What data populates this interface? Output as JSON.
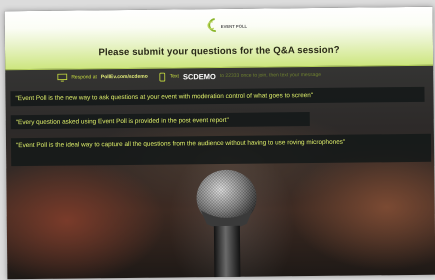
{
  "header": {
    "logo_text": "EVENT POLL",
    "title": "Please submit your questions for the Q&A session?"
  },
  "instructions": {
    "respond_prefix": "Respond at",
    "respond_url": "PollEv.com/scdemo",
    "text_prefix": "Text",
    "text_code": "SCDEMO",
    "text_suffix": "to 22333 once to join, then text your message"
  },
  "questions": [
    "\"Event Poll is the new way to ask questions at your event with moderation control of what goes to screen\"",
    "\"Every question asked using Event Poll is provided in the post event report\"",
    "\"Event Poll is the ideal way to capture all the questions from the audience without having to use roving microphones\""
  ],
  "colors": {
    "accent": "#cde67f",
    "question_text": "#dff06a"
  }
}
